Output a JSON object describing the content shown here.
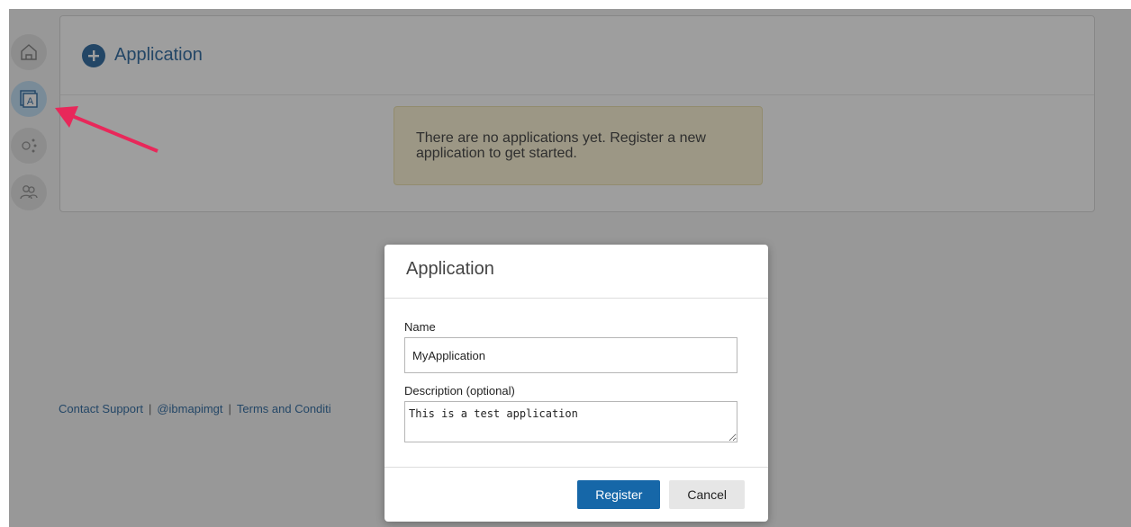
{
  "card": {
    "title": "Application",
    "notice": "There are no applications yet. Register a new application to get started."
  },
  "footer": {
    "contact": "Contact Support",
    "twitter": "@ibmapimgt",
    "terms": "Terms and Conditi"
  },
  "modal": {
    "title": "Application",
    "name_label": "Name",
    "name_value": "MyApplication",
    "description_label": "Description (optional)",
    "description_value": "This is a test application",
    "register_label": "Register",
    "cancel_label": "Cancel"
  },
  "colors": {
    "accent": "#1f5f9a",
    "primary_button": "#1667a8",
    "arrow": "#e8285a",
    "notice_bg": "#fbf3d1"
  },
  "icons": [
    "home-icon",
    "apps-icon",
    "apis-icon",
    "users-icon",
    "plus-icon"
  ]
}
